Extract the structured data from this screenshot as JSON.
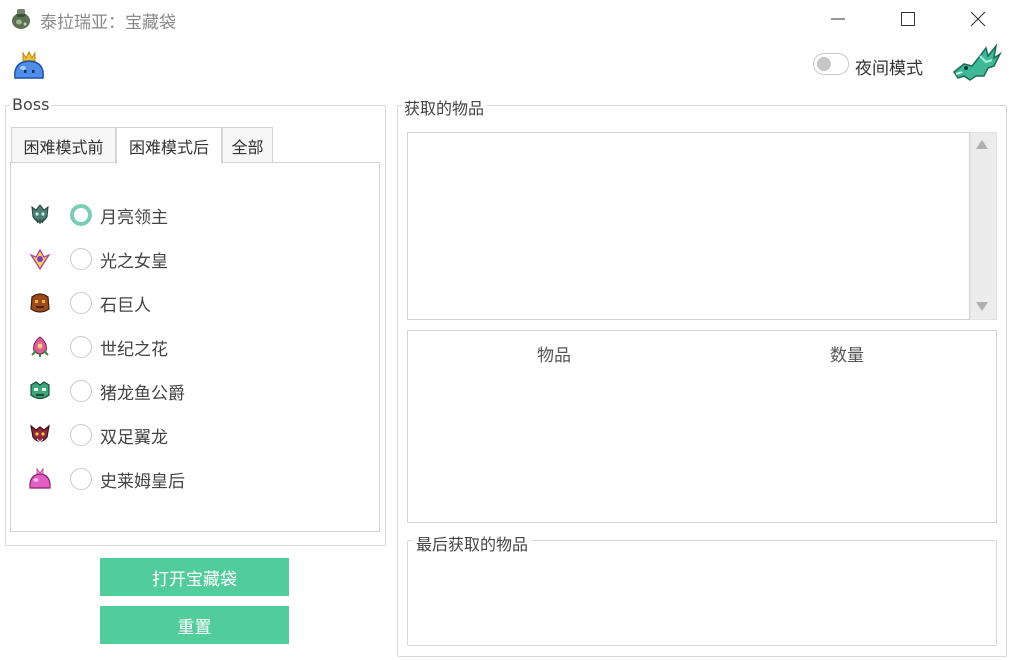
{
  "window": {
    "title": "泰拉瑞亚：宝藏袋",
    "app_icon": "treasure-bag-icon",
    "controls": [
      "minimize-icon",
      "maximize-icon",
      "close-icon"
    ]
  },
  "header": {
    "left_icon": "king-slime-icon",
    "night_mode_label": "夜间模式",
    "night_mode_on": false,
    "right_icon": "dragon-icon"
  },
  "boss_panel": {
    "title": "Boss",
    "tabs": [
      {
        "label": "困难模式前",
        "active": false
      },
      {
        "label": "困难模式后",
        "active": true
      },
      {
        "label": "全部",
        "active": false
      }
    ],
    "bosses": [
      {
        "label": "月亮领主",
        "icon": "moon-lord-icon",
        "selected": true
      },
      {
        "label": "光之女皇",
        "icon": "empress-of-light-icon",
        "selected": false
      },
      {
        "label": "石巨人",
        "icon": "golem-icon",
        "selected": false
      },
      {
        "label": "世纪之花",
        "icon": "plantera-icon",
        "selected": false
      },
      {
        "label": "猪龙鱼公爵",
        "icon": "duke-fishron-icon",
        "selected": false
      },
      {
        "label": "双足翼龙",
        "icon": "betsy-icon",
        "selected": false
      },
      {
        "label": "史莱姆皇后",
        "icon": "queen-slime-icon",
        "selected": false
      }
    ]
  },
  "actions": {
    "open_label": "打开宝藏袋",
    "reset_label": "重置"
  },
  "items_panel": {
    "title": "获取的物品",
    "text_content": "",
    "columns": [
      "物品",
      "数量"
    ],
    "rows": [],
    "last_title": "最后获取的物品",
    "last_content": ""
  },
  "colors": {
    "accent": "#53cc9c",
    "radio_checked": "#7ccdb6",
    "border": "#d4d4d4"
  }
}
